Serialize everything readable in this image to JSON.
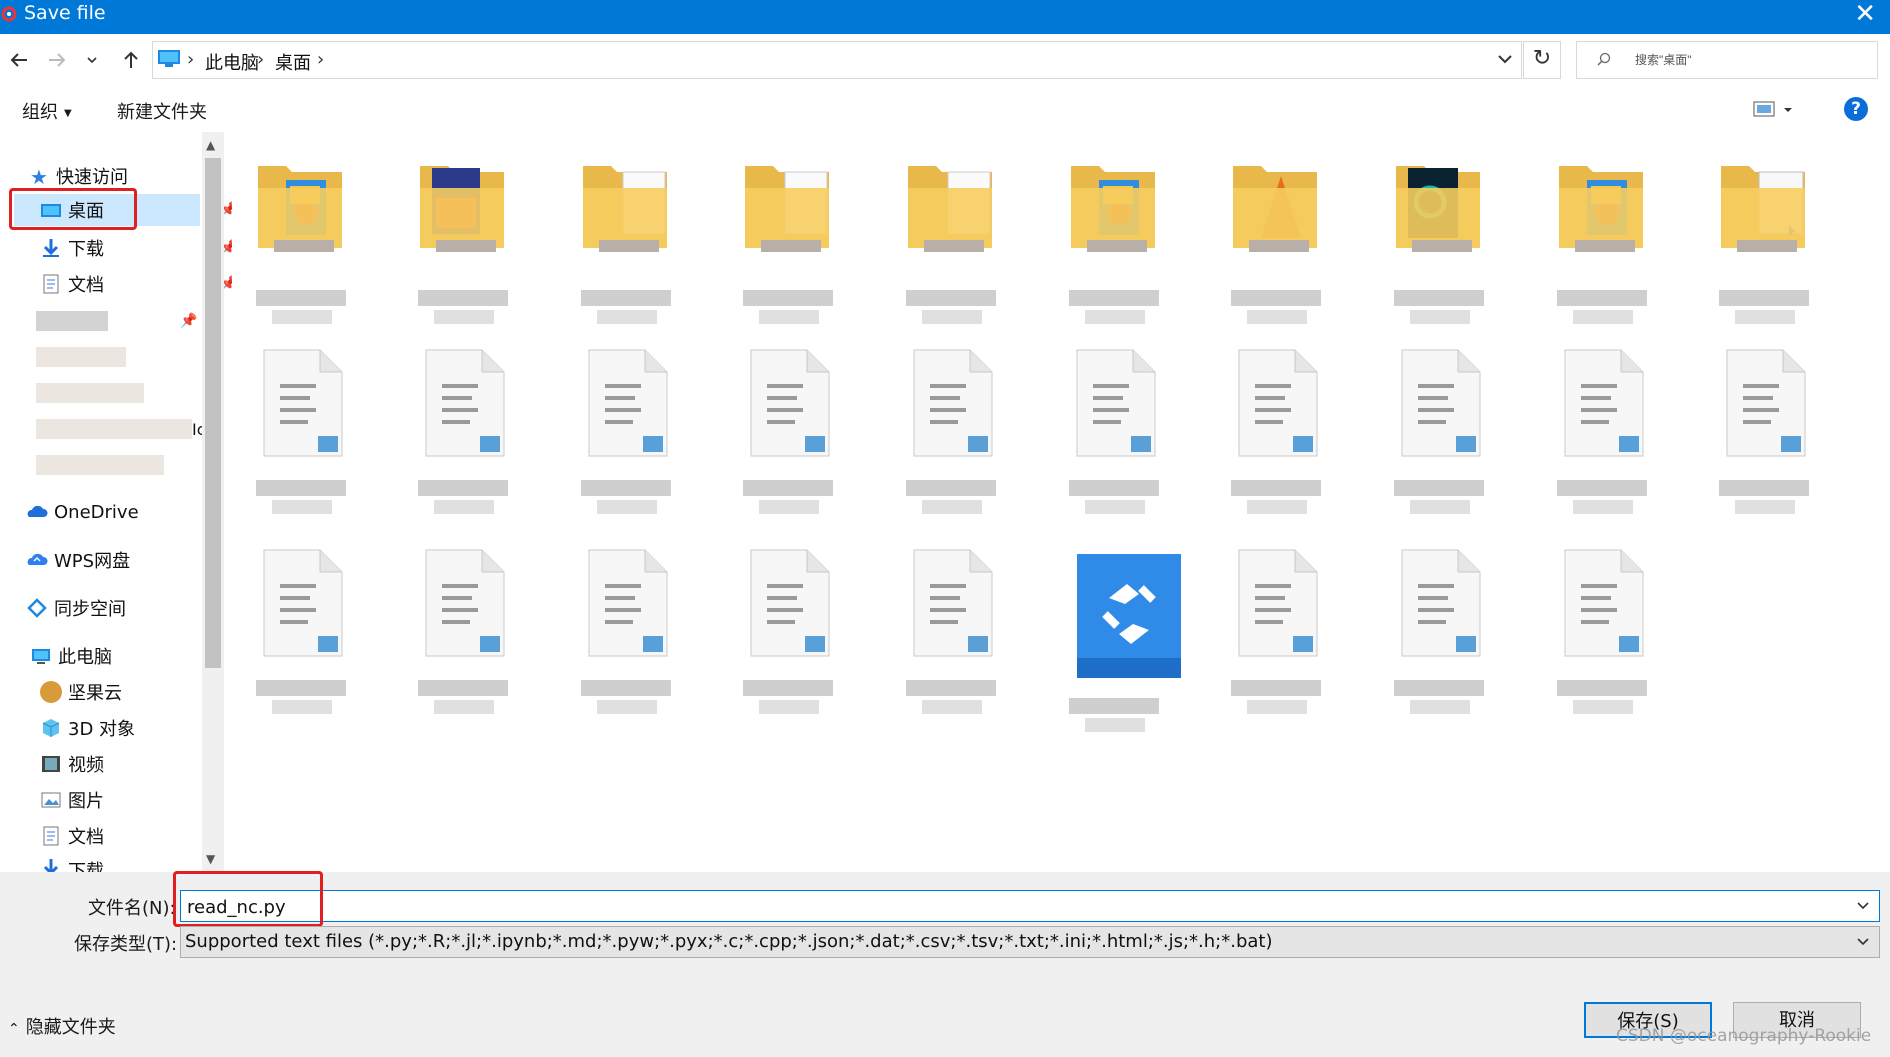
{
  "window": {
    "title": "Save file",
    "accent": "#0078d7"
  },
  "address": {
    "crumbs": [
      "此电脑",
      "桌面"
    ],
    "search_placeholder": "搜索\"桌面\""
  },
  "toolbar": {
    "organize": "组织",
    "new_folder": "新建文件夹",
    "help": "?"
  },
  "sidebar": {
    "quick_access": "快速访问",
    "items": [
      {
        "label": "桌面",
        "icon": "desktop-icon",
        "pinned": true,
        "selected": true
      },
      {
        "label": "下载",
        "icon": "download-icon",
        "pinned": true
      },
      {
        "label": "文档",
        "icon": "document-icon",
        "pinned": true
      }
    ],
    "onedrive": "OneDrive",
    "wps": "WPS网盘",
    "sync": "同步空间",
    "this_pc": "此电脑",
    "pc_items": [
      {
        "label": "坚果云",
        "icon": "jianguoyun-icon"
      },
      {
        "label": "3D 对象",
        "icon": "3d-objects-icon"
      },
      {
        "label": "视频",
        "icon": "video-icon"
      },
      {
        "label": "图片",
        "icon": "pictures-icon"
      },
      {
        "label": "文档",
        "icon": "document-icon"
      },
      {
        "label": "下载",
        "icon": "download-icon"
      }
    ],
    "partial_text": "Ic"
  },
  "form": {
    "filename_label": "文件名(N):",
    "filename_value": "read_nc.py",
    "filetype_label": "保存类型(T):",
    "filetype_value": "Supported text files (*.py;*.R;*.jl;*.ipynb;*.md;*.pyw;*.pyx;*.c;*.cpp;*.json;*.dat;*.csv;*.tsv;*.txt;*.ini;*.html;*.js;*.h;*.bat)"
  },
  "footer": {
    "hide_folders": "隐藏文件夹",
    "save": "保存(S)",
    "cancel": "取消"
  },
  "watermark": "CSDN @oceanography-Rookie",
  "files": {
    "row1": [
      "folder-media",
      "folder-book",
      "folder-docs",
      "folder-docs",
      "folder-empty",
      "folder-media",
      "folder-matlab",
      "folder-dark",
      "folder-media",
      "folder-vscode"
    ],
    "row2": [
      "vscode-file",
      "vscode-file",
      "vscode-file",
      "vscode-file",
      "vscode-file",
      "vscode-file",
      "vscode-file",
      "vscode-file",
      "vscode-file",
      "vscode-file"
    ],
    "row3": [
      "vscode-file",
      "vscode-file",
      "vscode-file",
      "vscode-file",
      "vscode-file",
      "app-shortcut",
      "vscode-file",
      "vscode-file",
      "vscode-file"
    ]
  }
}
